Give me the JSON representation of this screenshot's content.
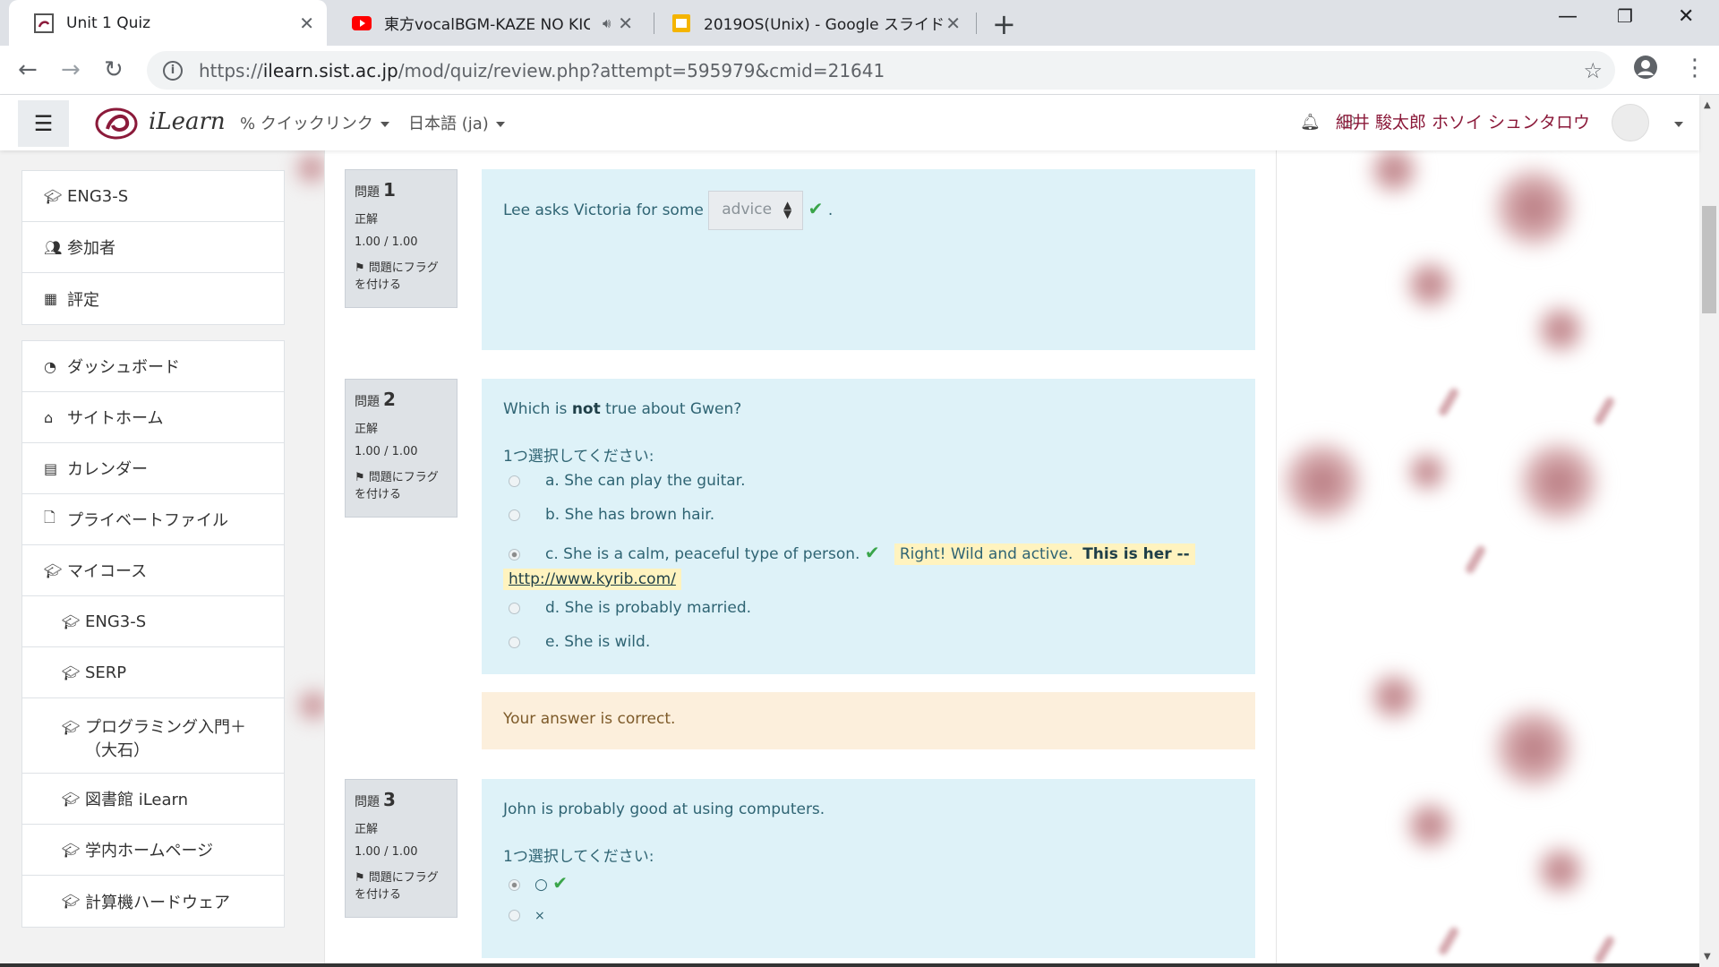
{
  "browser": {
    "tabs": [
      {
        "title": "Unit 1 Quiz",
        "favicon": "moodle-favicon",
        "active": true
      },
      {
        "title": "東方vocalBGM-KAZE NO KIC",
        "favicon": "youtube-icon",
        "active": false,
        "audio": true
      },
      {
        "title": "2019OS(Unix) - Google スライド",
        "favicon": "google-slides-icon",
        "active": false
      }
    ],
    "url_scheme": "https://",
    "url_host": "ilearn.sist.ac.jp",
    "url_path": "/mod/quiz/review.php?attempt=595979&cmid=21641"
  },
  "navbar": {
    "site_name": "iLearn",
    "quicklinks": "クイックリンク",
    "language": "日本語 (ja)",
    "user_name": "細井 駿太郎 ホソイ シュンタロウ"
  },
  "drawer": {
    "group1": [
      {
        "icon": "graduation-cap-icon",
        "label": "ENG3-S"
      },
      {
        "icon": "users-icon",
        "label": "参加者"
      },
      {
        "icon": "table-icon",
        "label": "評定"
      }
    ],
    "group2": [
      {
        "icon": "dashboard-icon",
        "label": "ダッシュボード"
      },
      {
        "icon": "home-icon",
        "label": "サイトホーム"
      },
      {
        "icon": "calendar-icon",
        "label": "カレンダー"
      },
      {
        "icon": "file-icon",
        "label": "プライベートファイル"
      },
      {
        "icon": "graduation-cap-icon",
        "label": "マイコース"
      },
      {
        "icon": "graduation-cap-icon",
        "label": "ENG3-S"
      },
      {
        "icon": "graduation-cap-icon",
        "label": "SERP"
      },
      {
        "icon": "graduation-cap-icon",
        "label": "プログラミング入門＋（大石）"
      },
      {
        "icon": "graduation-cap-icon",
        "label": "図書館 iLearn"
      },
      {
        "icon": "graduation-cap-icon",
        "label": "学内ホームページ"
      },
      {
        "icon": "graduation-cap-icon",
        "label": "計算機ハードウェア"
      }
    ]
  },
  "questions": [
    {
      "label": "問題",
      "number": "1",
      "state": "正解",
      "grade": "1.00 / 1.00",
      "flag": "問題にフラグを付ける",
      "text_before": "Lee asks Victoria for some",
      "select_value": "advice",
      "text_after": "."
    },
    {
      "label": "問題",
      "number": "2",
      "state": "正解",
      "grade": "1.00 / 1.00",
      "flag": "問題にフラグを付ける",
      "prompt_a": "Which is",
      "prompt_b": "not",
      "prompt_c": "true about Gwen?",
      "choose": "1つ選択してください:",
      "options": [
        "a. She can play the guitar.",
        "b. She has brown hair.",
        "c. She is a calm, peaceful type of person.",
        "d. She is probably married.",
        "e. She is wild."
      ],
      "selected_feedback_a": "Right! Wild and active.",
      "selected_feedback_b": "This is her --",
      "selected_feedback_link": "http://www.kyrib.com/",
      "general_feedback": "Your answer is correct."
    },
    {
      "label": "問題",
      "number": "3",
      "state": "正解",
      "grade": "1.00 / 1.00",
      "flag": "問題にフラグを付ける",
      "prompt": "John is probably good at using computers.",
      "choose": "1つ選択してください:",
      "options": [
        "○",
        "×"
      ]
    }
  ]
}
